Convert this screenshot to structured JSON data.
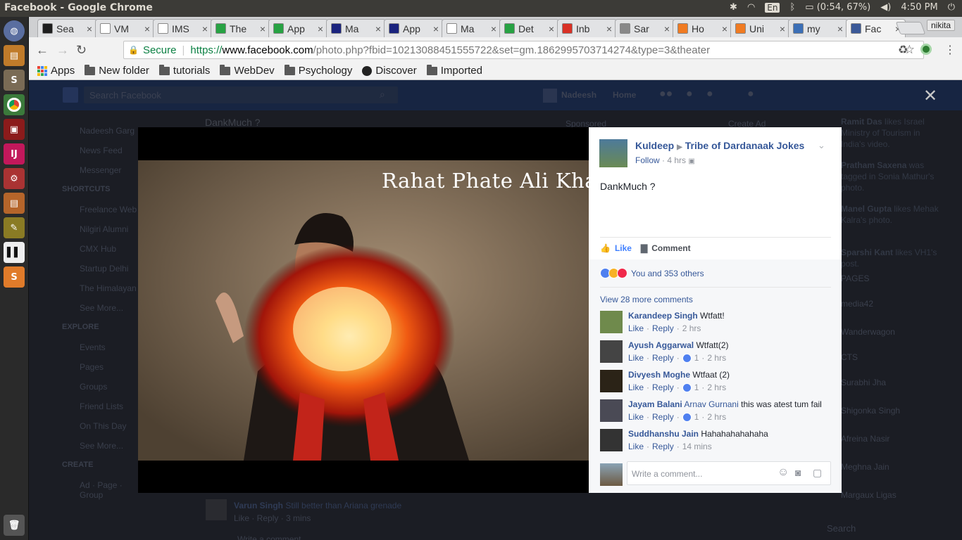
{
  "os": {
    "window_title": "Facebook - Google Chrome",
    "keyboard_layout": "En",
    "battery": "(0:54, 67%)",
    "clock": "4:50 PM"
  },
  "tabs": [
    {
      "label": "Sea",
      "favicon_color": "#1e1e1e"
    },
    {
      "label": "VM",
      "favicon_color": "#ffffff"
    },
    {
      "label": "IMS",
      "favicon_color": "#ffffff"
    },
    {
      "label": "The",
      "favicon_color": "#27a243"
    },
    {
      "label": "App",
      "favicon_color": "#27a243"
    },
    {
      "label": "Ma",
      "favicon_color": "#1a237e"
    },
    {
      "label": "App",
      "favicon_color": "#1a237e"
    },
    {
      "label": "Ma",
      "favicon_color": "#ffffff"
    },
    {
      "label": "Det",
      "favicon_color": "#27a243"
    },
    {
      "label": "Inb",
      "favicon_color": "#d93025"
    },
    {
      "label": "Sar",
      "favicon_color": "#888888"
    },
    {
      "label": "Ho",
      "favicon_color": "#f07b22"
    },
    {
      "label": "Uni",
      "favicon_color": "#f07b22"
    },
    {
      "label": "my",
      "favicon_color": "#3b6fb6"
    },
    {
      "label": "Fac",
      "favicon_color": "#3b5998"
    }
  ],
  "profile_name": "nikita",
  "address": {
    "secure_label": "Secure",
    "scheme": "https://",
    "host": "www.facebook.com",
    "path": "/photo.php?fbid=10213088451555722&set=gm.1862995703714274&type=3&theater"
  },
  "bookmarks": [
    "Apps",
    "New folder",
    "tutorials",
    "WebDev",
    "Psychology",
    "Discover",
    "Imported"
  ],
  "background_page": {
    "search_placeholder": "Search Facebook",
    "user": "Nadeesh",
    "home": "Home",
    "post_title": "DankMuch ?",
    "sponsored": "Sponsored",
    "create_ad": "Create Ad",
    "left_nav": [
      "Nadeesh Garg",
      "News Feed",
      "Messenger",
      "SHORTCUTS",
      "Freelance Web",
      "Nilgiri Alumni",
      "CMX Hub",
      "Startup Delhi",
      "The Himalayan",
      "See More...",
      "EXPLORE",
      "Events",
      "Pages",
      "Groups",
      "Friend Lists",
      "On This Day",
      "See More...",
      "CREATE",
      "Ad · Page · Group"
    ],
    "ticker": [
      {
        "name": "Ramit Das",
        "text": " likes Israel Ministry of Tourism in India's video."
      },
      {
        "name": "Pratham Saxena",
        "text": " was tagged in Sonia Mathur's photo."
      },
      {
        "name": "Manel Gupta",
        "text": " likes Mehak Kalra's photo."
      },
      {
        "name": "Sparshi Kant",
        "text": " likes VH1's post."
      }
    ],
    "right_labels": [
      "PAGES",
      "media42",
      "Wanderwagon",
      "CTS"
    ],
    "contacts": [
      "Surabhi Jha",
      "Shigonka Singh",
      "Afreina Nasir",
      "Meghna Jain",
      "Margaux Ligas"
    ],
    "chat_search": "Search",
    "bottom_comment_name": "Varun Singh",
    "bottom_comment_text": "Still better than Ariana grenade",
    "bottom_comment_meta": "Like · Reply · 3 mins",
    "bottom_write": "Write a comment..."
  },
  "photo": {
    "caption": "Rahat Phate Ali Khan"
  },
  "post": {
    "author": "Kuldeep",
    "group": "Tribe of Dardanaak Jokes",
    "follow": "Follow",
    "time": "4 hrs",
    "text": "DankMuch ?",
    "like_label": "Like",
    "comment_label": "Comment",
    "reactions_text": "You and 353 others",
    "view_more": "View 28 more comments",
    "comments": [
      {
        "name": "Karandeep Singh",
        "mention": "",
        "text": "Wtfatt!",
        "likes": "",
        "time": "2 hrs",
        "avatar_color": "#6f8a4c"
      },
      {
        "name": "Ayush Aggarwal",
        "mention": "",
        "text": "Wtfatt(2)",
        "likes": "1",
        "time": "2 hrs",
        "avatar_color": "#444444"
      },
      {
        "name": "Divyesh Moghe",
        "mention": "",
        "text": "Wtfaat (2)",
        "likes": "1",
        "time": "2 hrs",
        "avatar_color": "#2b2317"
      },
      {
        "name": "Jayam Balani",
        "mention": "Arnav Gurnani",
        "text": "this was atest tum fail",
        "likes": "1",
        "time": "2 hrs",
        "avatar_color": "#4a4a55"
      },
      {
        "name": "Suddhanshu Jain",
        "mention": "",
        "text": "Hahahahahahaha",
        "likes": "",
        "time": "14 mins",
        "avatar_color": "#333333"
      }
    ],
    "comment_like": "Like",
    "comment_reply": "Reply",
    "write_placeholder": "Write a comment..."
  }
}
